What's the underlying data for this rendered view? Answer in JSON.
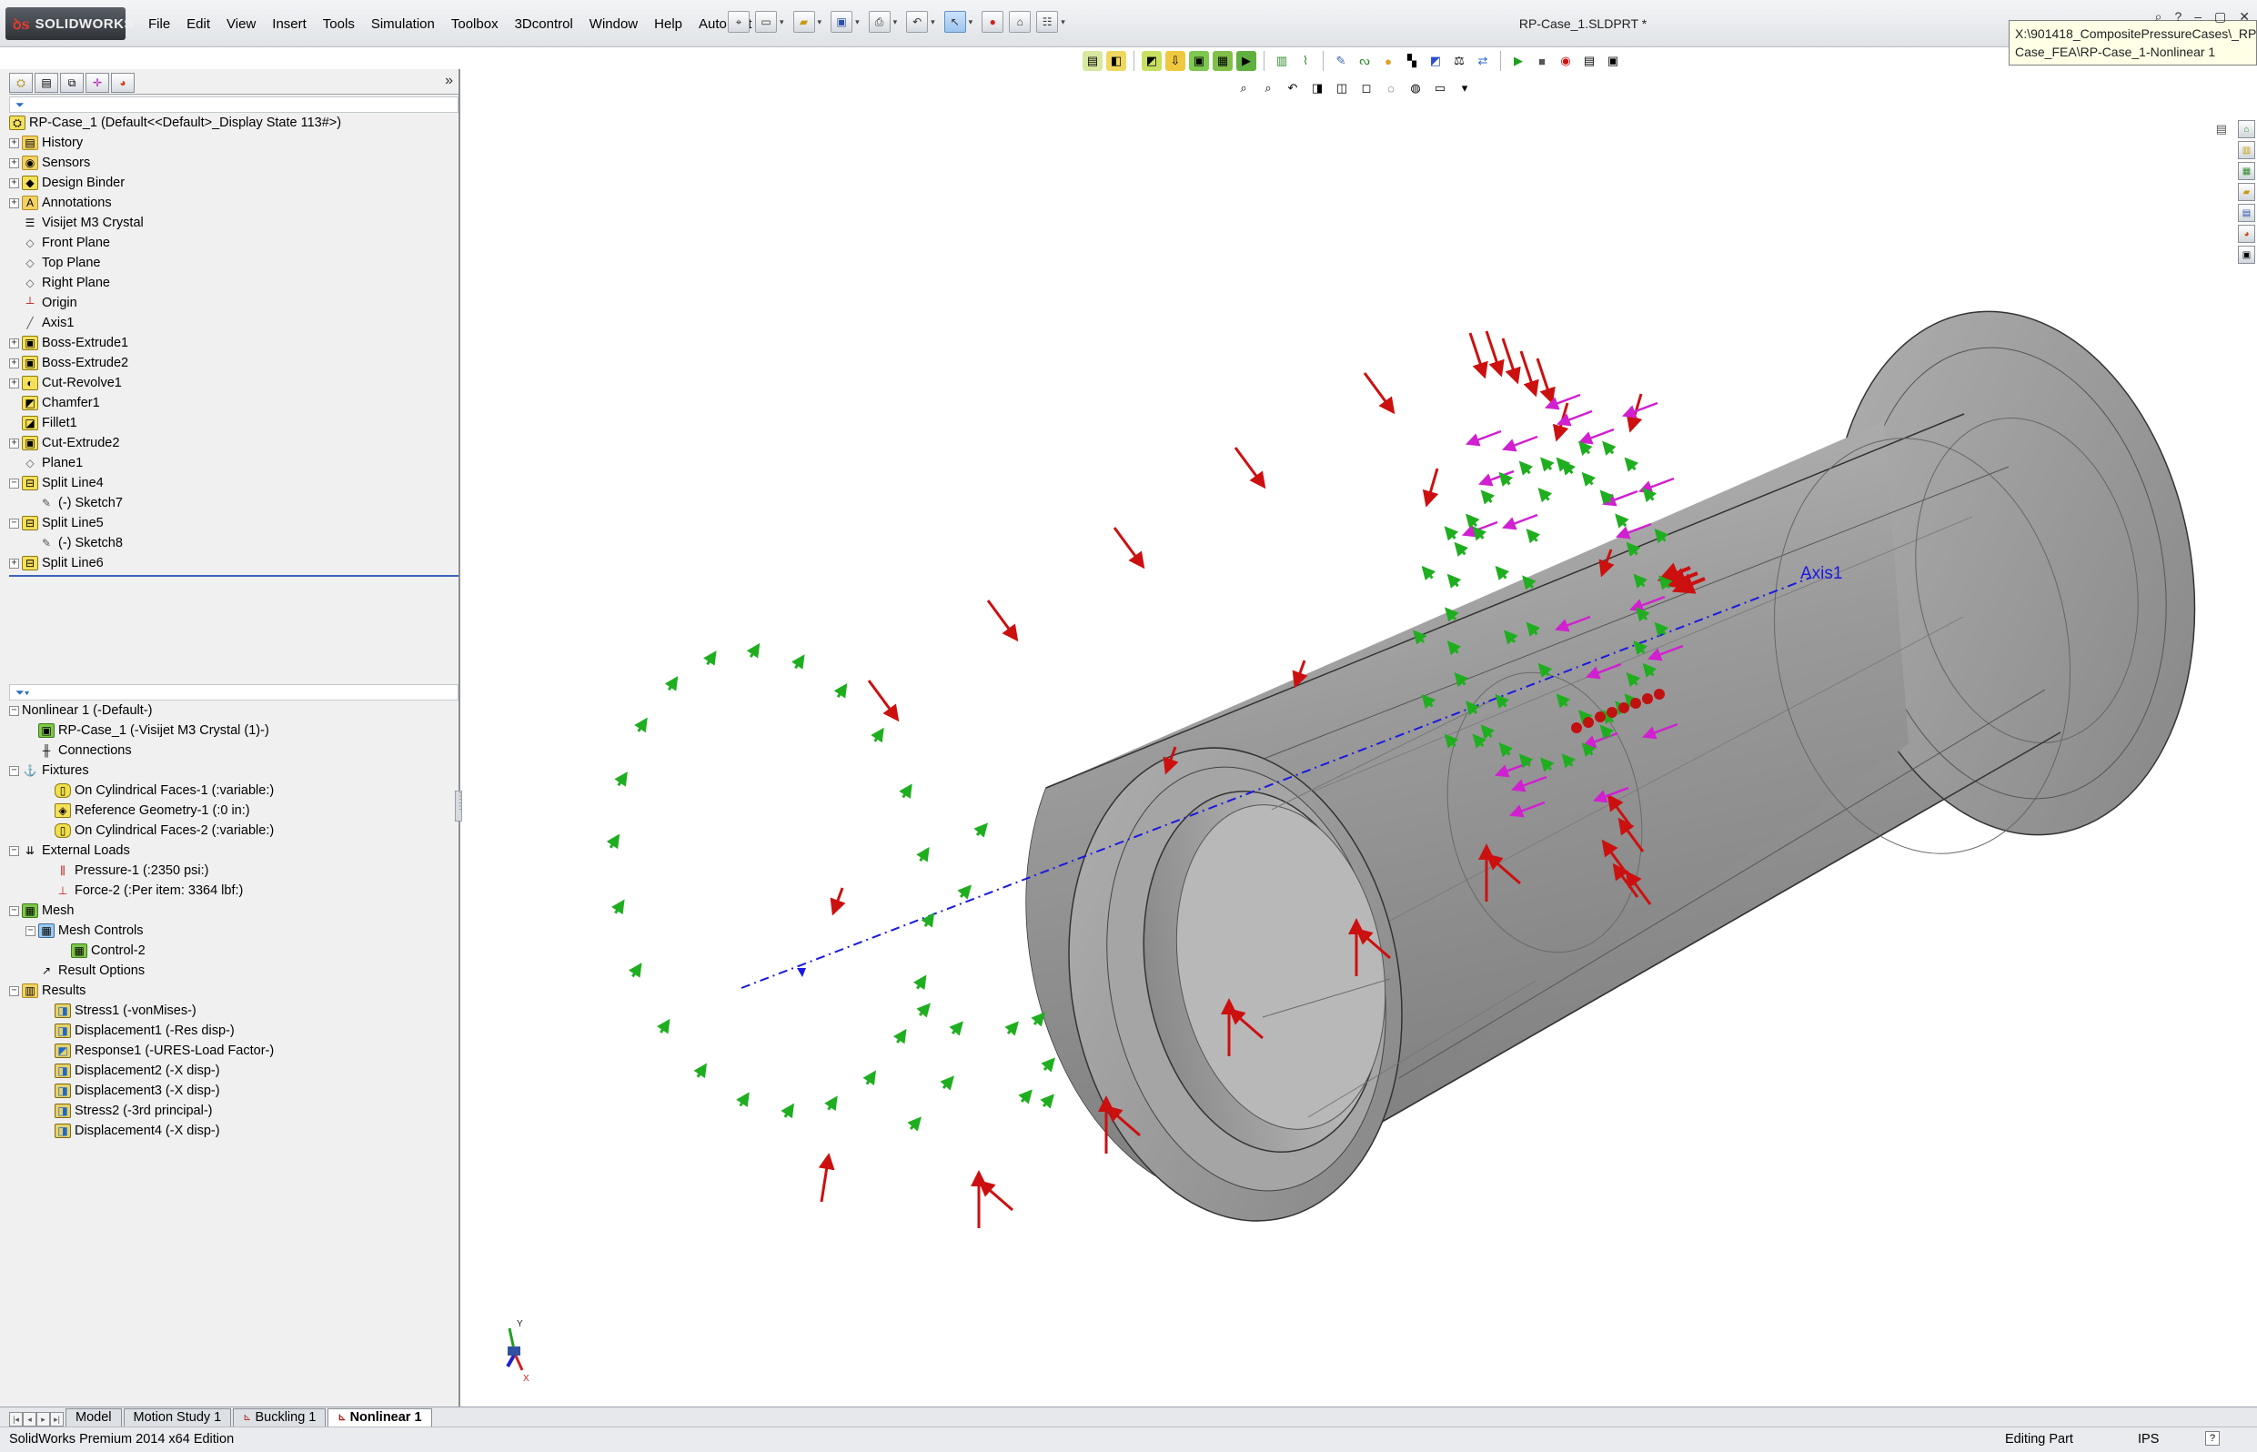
{
  "app": {
    "brand": "SOLIDWORKS",
    "document_title": "RP-Case_1.SLDPRT *",
    "path_tooltip_line1": "X:\\901418_CompositePressureCases\\_RP-",
    "path_tooltip_line2": "Case_FEA\\RP-Case_1-Nonlinear 1"
  },
  "menu": [
    "File",
    "Edit",
    "View",
    "Insert",
    "Tools",
    "Simulation",
    "Toolbox",
    "3Dcontrol",
    "Window",
    "Help",
    "AutoPart"
  ],
  "quick_toolbar_icons": [
    "pin-icon",
    "new-document-icon",
    "open-icon",
    "save-icon",
    "print-icon",
    "undo-icon",
    "select-icon",
    "traffic-light-icon",
    "file-properties-icon",
    "options-icon"
  ],
  "feature_tree": {
    "root": "RP-Case_1  (Default<<Default>_Display State 113#>)",
    "items": [
      {
        "label": "History",
        "icon": "history-folder-icon",
        "expander": "+",
        "level": 1
      },
      {
        "label": "Sensors",
        "icon": "sensors-icon",
        "expander": "+",
        "level": 1
      },
      {
        "label": "Design Binder",
        "icon": "design-binder-icon",
        "expander": "+",
        "level": 1
      },
      {
        "label": "Annotations",
        "icon": "annotations-icon",
        "expander": "+",
        "level": 1
      },
      {
        "label": "Visijet M3 Crystal",
        "icon": "material-icon",
        "expander": "",
        "level": 1
      },
      {
        "label": "Front Plane",
        "icon": "plane-icon",
        "expander": "",
        "level": 1
      },
      {
        "label": "Top Plane",
        "icon": "plane-icon",
        "expander": "",
        "level": 1
      },
      {
        "label": "Right Plane",
        "icon": "plane-icon",
        "expander": "",
        "level": 1
      },
      {
        "label": "Origin",
        "icon": "origin-icon",
        "expander": "",
        "level": 1
      },
      {
        "label": "Axis1",
        "icon": "axis-icon",
        "expander": "",
        "level": 1
      },
      {
        "label": "Boss-Extrude1",
        "icon": "boss-extrude-icon",
        "expander": "+",
        "level": 1
      },
      {
        "label": "Boss-Extrude2",
        "icon": "boss-extrude-icon",
        "expander": "+",
        "level": 1
      },
      {
        "label": "Cut-Revolve1",
        "icon": "cut-revolve-icon",
        "expander": "+",
        "level": 1
      },
      {
        "label": "Chamfer1",
        "icon": "chamfer-icon",
        "expander": "",
        "level": 1
      },
      {
        "label": "Fillet1",
        "icon": "fillet-icon",
        "expander": "",
        "level": 1
      },
      {
        "label": "Cut-Extrude2",
        "icon": "cut-extrude-icon",
        "expander": "+",
        "level": 1
      },
      {
        "label": "Plane1",
        "icon": "plane-icon",
        "expander": "",
        "level": 1
      },
      {
        "label": "Split Line4",
        "icon": "split-line-icon",
        "expander": "−",
        "level": 1
      },
      {
        "label": "(-) Sketch7",
        "icon": "sketch-icon",
        "expander": "",
        "level": 2
      },
      {
        "label": "Split Line5",
        "icon": "split-line-icon",
        "expander": "−",
        "level": 1
      },
      {
        "label": "(-) Sketch8",
        "icon": "sketch-icon",
        "expander": "",
        "level": 2
      },
      {
        "label": "Split Line6",
        "icon": "split-line-icon",
        "expander": "+",
        "level": 1
      }
    ]
  },
  "study_tree": {
    "root": "Nonlinear 1 (-Default-)",
    "items": [
      {
        "label": "RP-Case_1 (-Visijet M3 Crystal (1)-)",
        "icon": "part-icon",
        "expander": "",
        "level": 2
      },
      {
        "label": "Connections",
        "icon": "connections-icon",
        "expander": "",
        "level": 2
      },
      {
        "label": "Fixtures",
        "icon": "fixtures-icon",
        "expander": "−",
        "level": 1
      },
      {
        "label": "On Cylindrical Faces-1 (:variable:)",
        "icon": "cylindrical-fixture-icon",
        "expander": "",
        "level": 3
      },
      {
        "label": "Reference Geometry-1 (:0 in:)",
        "icon": "reference-geometry-icon",
        "expander": "",
        "level": 3
      },
      {
        "label": "On Cylindrical Faces-2 (:variable:)",
        "icon": "cylindrical-fixture-icon",
        "expander": "",
        "level": 3
      },
      {
        "label": "External Loads",
        "icon": "external-loads-icon",
        "expander": "−",
        "level": 1
      },
      {
        "label": "Pressure-1 (:2350 psi:)",
        "icon": "pressure-icon",
        "expander": "",
        "level": 3
      },
      {
        "label": "Force-2 (:Per item: 3364 lbf:)",
        "icon": "force-icon",
        "expander": "",
        "level": 3
      },
      {
        "label": "Mesh",
        "icon": "mesh-icon",
        "expander": "−",
        "level": 1
      },
      {
        "label": "Mesh Controls",
        "icon": "mesh-controls-icon",
        "expander": "−",
        "level": 2
      },
      {
        "label": "Control-2",
        "icon": "mesh-control-icon",
        "expander": "",
        "level": 4
      },
      {
        "label": "Result Options",
        "icon": "result-options-icon",
        "expander": "",
        "level": 2
      },
      {
        "label": "Results",
        "icon": "results-folder-icon",
        "expander": "−",
        "level": 1
      },
      {
        "label": "Stress1 (-vonMises-)",
        "icon": "result-plot-icon",
        "expander": "",
        "level": 3
      },
      {
        "label": "Displacement1 (-Res disp-)",
        "icon": "result-plot-icon",
        "expander": "",
        "level": 3
      },
      {
        "label": "Response1 (-URES-Load Factor-)",
        "icon": "response-plot-icon",
        "expander": "",
        "level": 3
      },
      {
        "label": "Displacement2 (-X disp-)",
        "icon": "result-plot-icon",
        "expander": "",
        "level": 3
      },
      {
        "label": "Displacement3 (-X disp-)",
        "icon": "result-plot-icon",
        "expander": "",
        "level": 3
      },
      {
        "label": "Stress2 (-3rd principal-)",
        "icon": "result-plot-icon",
        "expander": "",
        "level": 3
      },
      {
        "label": "Displacement4 (-X disp-)",
        "icon": "result-plot-icon",
        "expander": "",
        "level": 3
      }
    ]
  },
  "viewport": {
    "axis_label": "Axis1",
    "triad_y": "Y",
    "triad_x": "X",
    "colors": {
      "part_body": "#9a9a9a",
      "pressure_arrows": "#cc1010",
      "force_arrows": "#d020d0",
      "fixture_arrows": "#20b020",
      "axis_line": "#1a1ae0"
    }
  },
  "bottom_tabs": [
    {
      "label": "Model",
      "active": false,
      "icon": ""
    },
    {
      "label": "Motion Study 1",
      "active": false,
      "icon": ""
    },
    {
      "label": "Buckling 1",
      "active": false,
      "icon": "study-icon"
    },
    {
      "label": "Nonlinear 1",
      "active": true,
      "icon": "study-icon"
    }
  ],
  "status": {
    "left": "SolidWorks Premium 2014 x64 Edition",
    "editing": "Editing Part",
    "units": "IPS",
    "help": "?"
  }
}
